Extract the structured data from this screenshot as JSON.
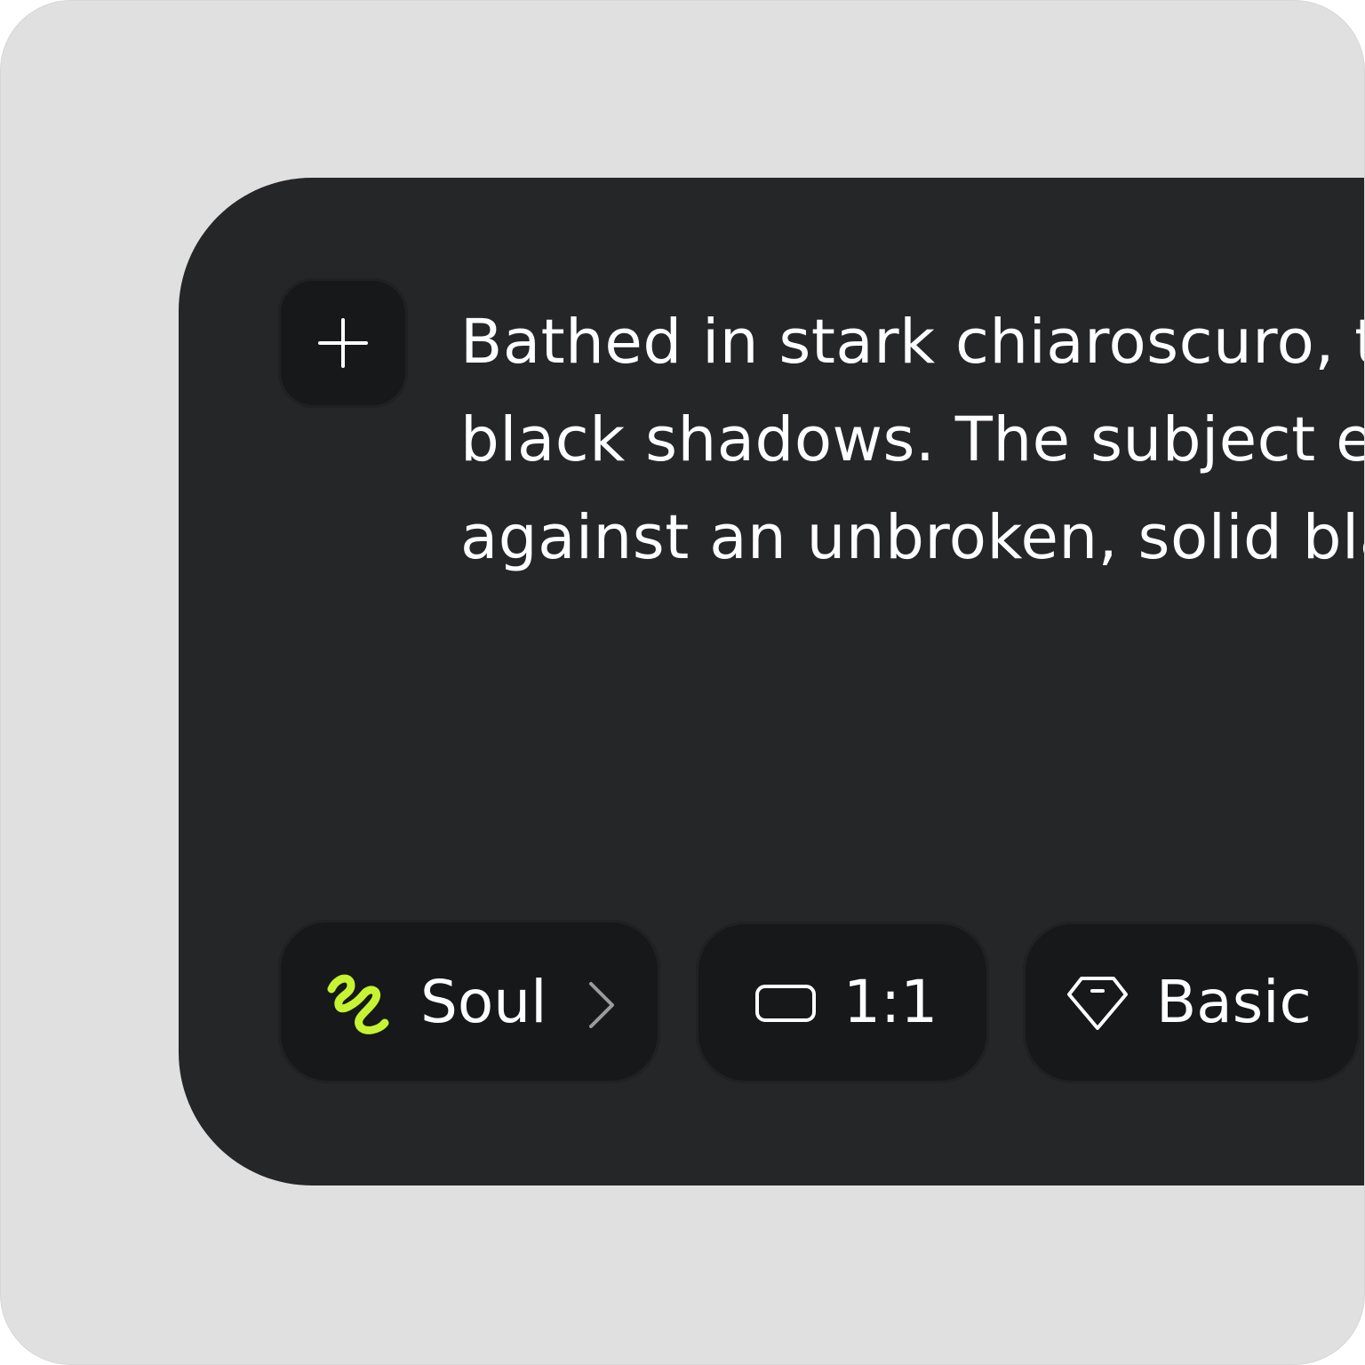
{
  "composer": {
    "add_button_icon": "plus-icon",
    "prompt_lines": [
      "Bathed in stark chiaroscuro, th",
      "black shadows. The subject e",
      "against an unbroken, solid bla"
    ]
  },
  "toolbar": {
    "model": {
      "icon": "squiggle-icon",
      "icon_color": "#c6f432",
      "label": "Soul",
      "trailing_icon": "chevron-right-icon"
    },
    "aspect_ratio": {
      "icon": "aspect-ratio-icon",
      "label": "1:1"
    },
    "quality": {
      "icon": "gem-icon",
      "label": "Basic"
    }
  },
  "colors": {
    "background": "#e0e0e0",
    "panel": "#252628",
    "chip": "#17181a",
    "text": "#ffffff",
    "accent": "#c6f432"
  }
}
